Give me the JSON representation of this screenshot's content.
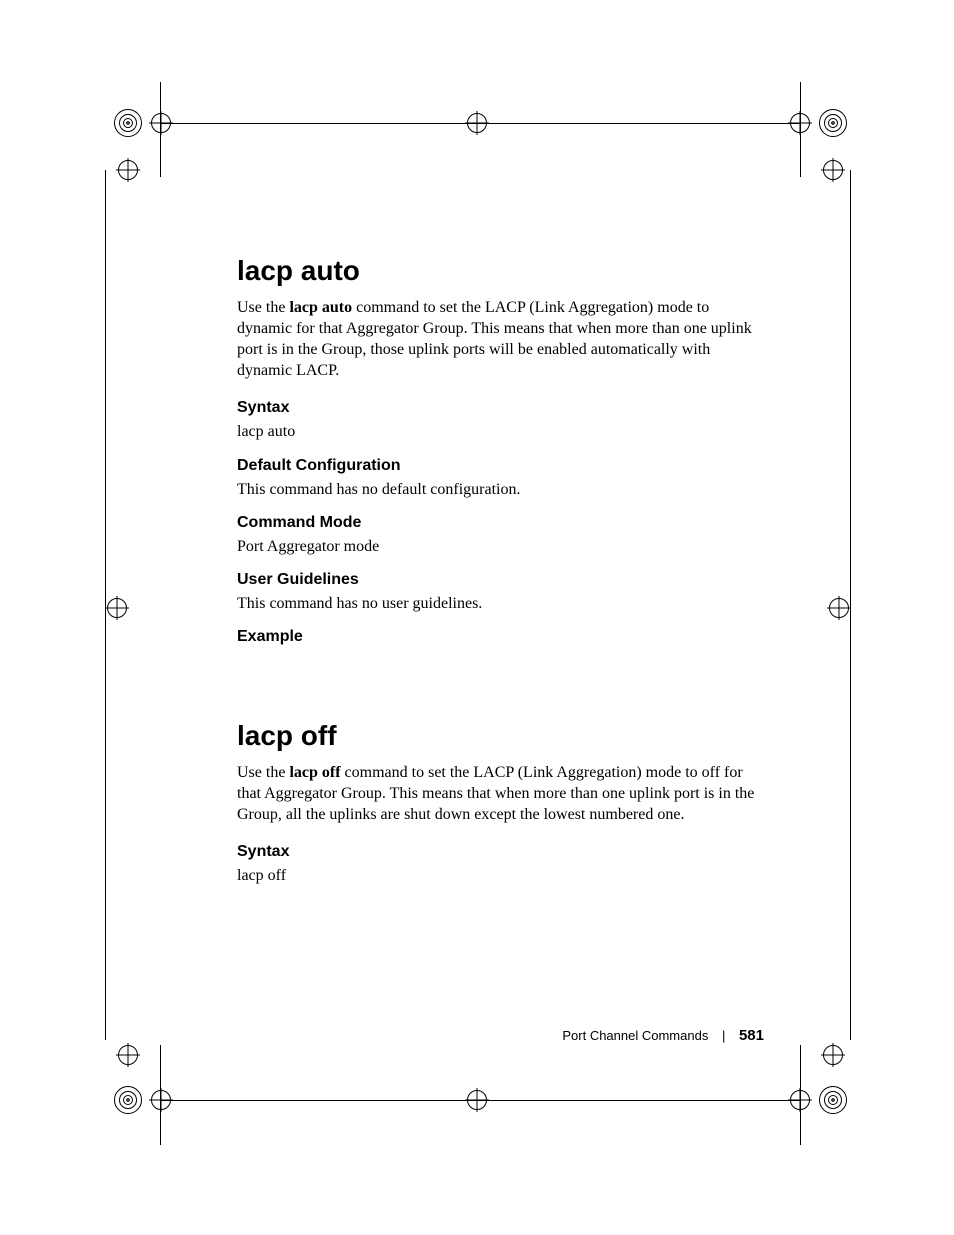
{
  "sections": [
    {
      "title": "lacp auto",
      "intro_pre": "Use the ",
      "intro_bold": "lacp auto",
      "intro_post": " command to set the LACP (Link Aggregation) mode to dynamic for that Aggregator Group. This means that when more than one uplink port is in the Group, those uplink ports will be enabled automatically with dynamic LACP.",
      "blocks": [
        {
          "heading": "Syntax",
          "text": "lacp auto"
        },
        {
          "heading": "Default Configuration",
          "text": "This command has no default configuration."
        },
        {
          "heading": "Command Mode",
          "text": "Port Aggregator mode"
        },
        {
          "heading": "User Guidelines",
          "text": "This command has no user guidelines."
        },
        {
          "heading": "Example",
          "text": ""
        }
      ]
    },
    {
      "title": "lacp off",
      "intro_pre": "Use the ",
      "intro_bold": "lacp off",
      "intro_post": " command to set the LACP (Link Aggregation) mode to off for that Aggregator Group. This means that when more than one uplink port is in the Group, all the uplinks are shut down except the lowest numbered one.",
      "blocks": [
        {
          "heading": "Syntax",
          "text": "lacp off"
        }
      ]
    }
  ],
  "footer": {
    "chapter": "Port Channel Commands",
    "page": "581"
  }
}
